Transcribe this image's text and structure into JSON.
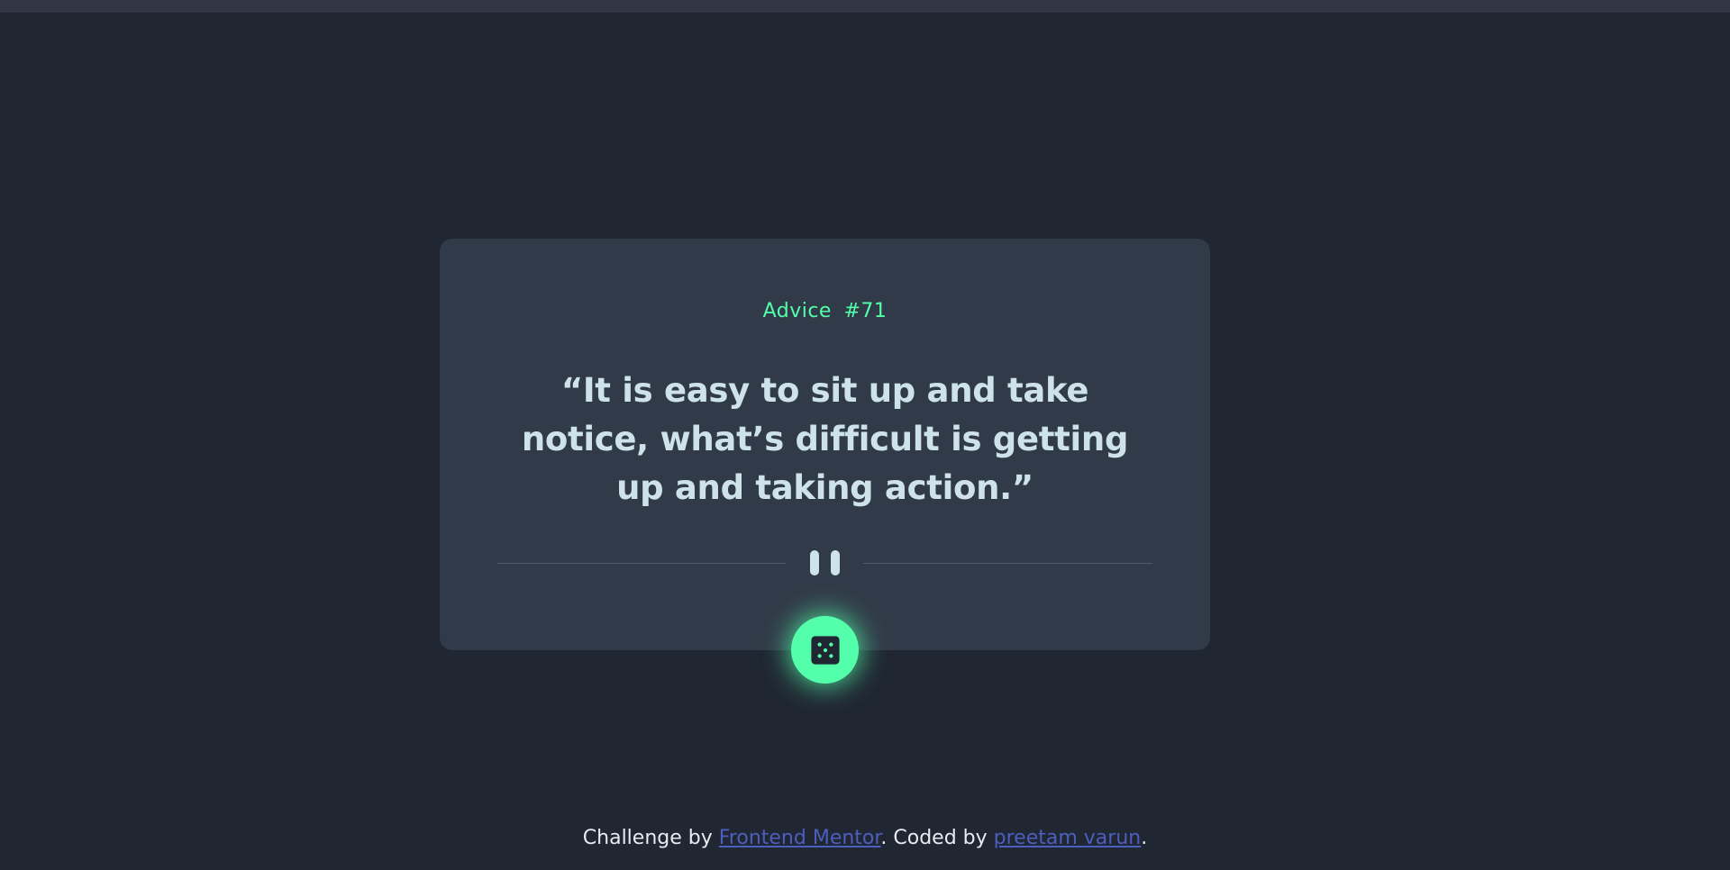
{
  "advice": {
    "label": "Advice",
    "number": "#71",
    "text": "“It is easy to sit up and take notice, what’s difficult is getting up and taking action.”"
  },
  "divider": {
    "icon": "pause-icon"
  },
  "dice_button": {
    "icon": "dice-icon"
  },
  "footer": {
    "prefix": "Challenge by ",
    "link1": "Frontend Mentor",
    "middle": ". Coded by ",
    "link2": "preetam varun",
    "suffix": "."
  },
  "colors": {
    "background": "#202632",
    "card": "#313A48",
    "accent": "#53FFAA",
    "text": "#CEE3E9",
    "link": "#4C5FBE"
  }
}
